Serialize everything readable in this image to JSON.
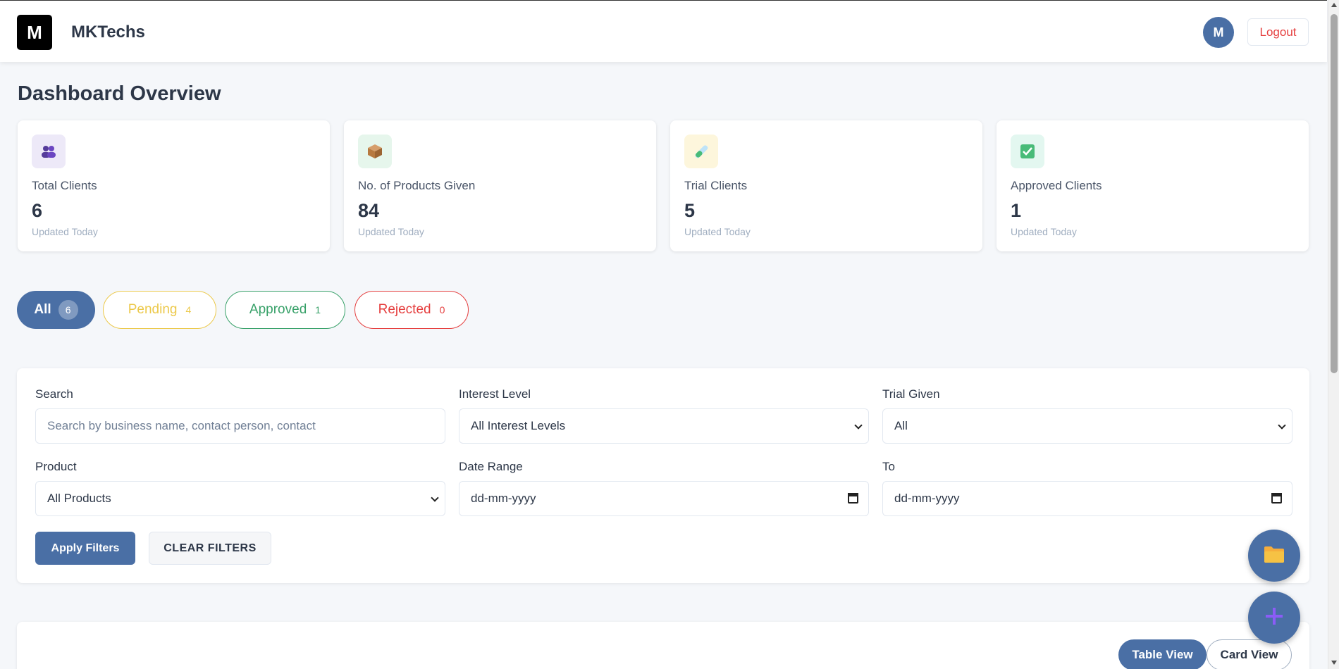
{
  "header": {
    "logo_letter": "M",
    "brand": "MKTechs",
    "avatar_letter": "M",
    "logout_label": "Logout"
  },
  "page_title": "Dashboard Overview",
  "stats": [
    {
      "label": "Total Clients",
      "value": "6",
      "sub": "Updated Today",
      "icon": "users-icon"
    },
    {
      "label": "No. of Products Given",
      "value": "84",
      "sub": "Updated Today",
      "icon": "package-icon"
    },
    {
      "label": "Trial Clients",
      "value": "5",
      "sub": "Updated Today",
      "icon": "test-tube-icon"
    },
    {
      "label": "Approved Clients",
      "value": "1",
      "sub": "Updated Today",
      "icon": "check-box-icon"
    }
  ],
  "tabs": [
    {
      "label": "All",
      "count": "6"
    },
    {
      "label": "Pending",
      "count": "4"
    },
    {
      "label": "Approved",
      "count": "1"
    },
    {
      "label": "Rejected",
      "count": "0"
    }
  ],
  "filters": {
    "search_label": "Search",
    "search_placeholder": "Search by business name, contact person, contact",
    "interest_label": "Interest Level",
    "interest_value": "All Interest Levels",
    "trial_label": "Trial Given",
    "trial_value": "All",
    "product_label": "Product",
    "product_value": "All Products",
    "date_label": "Date Range",
    "date_from_placeholder": "dd-mm-yyyy",
    "to_label": "To",
    "date_to_placeholder": "dd-mm-yyyy",
    "apply_label": "Apply Filters",
    "clear_label": "CLEAR FILTERS"
  },
  "views": {
    "table_label": "Table View",
    "card_label": "Card View"
  },
  "colors": {
    "primary": "#4a6fa5",
    "pending": "#ecc94b",
    "approved": "#38a169",
    "rejected": "#e53e3e"
  }
}
